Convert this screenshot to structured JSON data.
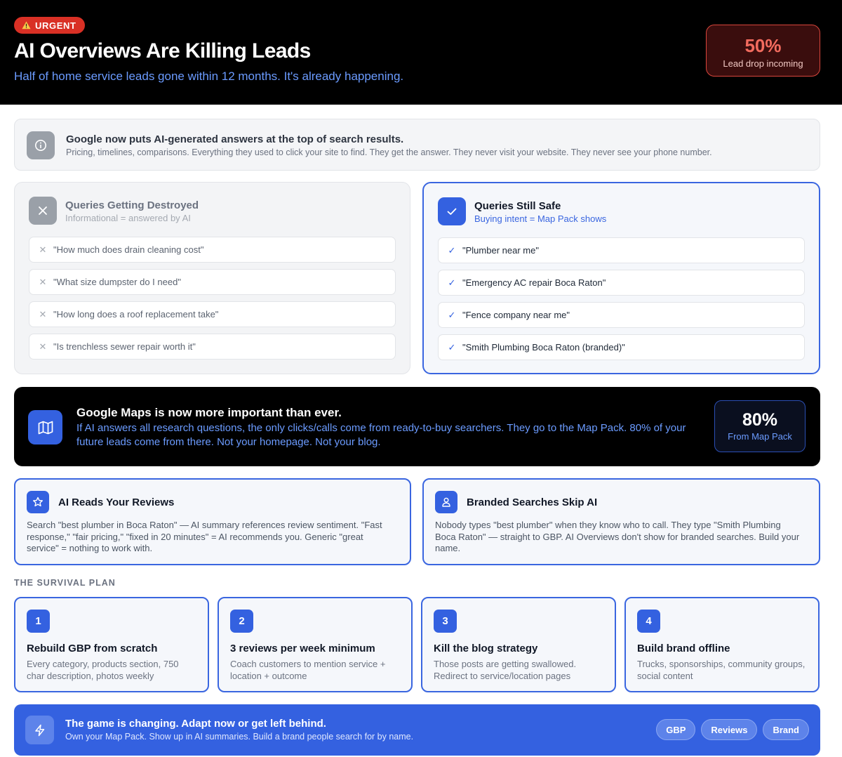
{
  "header": {
    "badge": "URGENT",
    "title": "AI Overviews Are Killing Leads",
    "subtitle": "Half of home service leads gone within 12 months. It's already happening.",
    "stat_value": "50%",
    "stat_label": "Lead drop incoming"
  },
  "info": {
    "icon": "info-icon",
    "title": "Google now puts AI-generated answers at the top of search results.",
    "description": "Pricing, timelines, comparisons. Everything they used to click your site to find. They get the answer. They never visit your website. They never see your phone number."
  },
  "destroyed": {
    "icon": "x-icon",
    "title": "Queries Getting Destroyed",
    "subtitle": "Informational = answered by AI",
    "items": [
      "\"How much does drain cleaning cost\"",
      "\"What size dumpster do I need\"",
      "\"How long does a roof replacement take\"",
      "\"Is trenchless sewer repair worth it\""
    ]
  },
  "safe": {
    "icon": "check-icon",
    "title": "Queries Still Safe",
    "subtitle": "Buying intent = Map Pack shows",
    "items": [
      "\"Plumber near me\"",
      "\"Emergency AC repair Boca Raton\"",
      "\"Fence company near me\"",
      "\"Smith Plumbing Boca Raton (branded)\""
    ]
  },
  "maps": {
    "icon": "map-icon",
    "title": "Google Maps is now more important than ever.",
    "description": "If AI answers all research questions, the only clicks/calls come from ready-to-buy searchers. They go to the Map Pack. 80% of your future leads come from there. Not your homepage. Not your blog.",
    "stat_value": "80%",
    "stat_label": "From Map Pack"
  },
  "features": [
    {
      "icon": "star-icon",
      "title": "AI Reads Your Reviews",
      "description": "Search \"best plumber in Boca Raton\" — AI summary references review sentiment. \"Fast response,\" \"fair pricing,\" \"fixed in 20 minutes\" = AI recommends you. Generic \"great service\" = nothing to work with."
    },
    {
      "icon": "user-icon",
      "title": "Branded Searches Skip AI",
      "description": "Nobody types \"best plumber\" when they know who to call. They type \"Smith Plumbing Boca Raton\" — straight to GBP. AI Overviews don't show for branded searches. Build your name."
    }
  ],
  "plan": {
    "label": "THE SURVIVAL PLAN",
    "steps": [
      {
        "num": "1",
        "title": "Rebuild GBP from scratch",
        "description": "Every category, products section, 750 char description, photos weekly"
      },
      {
        "num": "2",
        "title": "3 reviews per week minimum",
        "description": "Coach customers to mention service + location + outcome"
      },
      {
        "num": "3",
        "title": "Kill the blog strategy",
        "description": "Those posts are getting swallowed. Redirect to service/location pages"
      },
      {
        "num": "4",
        "title": "Build brand offline",
        "description": "Trucks, sponsorships, community groups, social content"
      }
    ]
  },
  "cta": {
    "icon": "lightning-icon",
    "title": "The game is changing. Adapt now or get left behind.",
    "description": "Own your Map Pack. Show up in AI summaries. Build a brand people search for by name.",
    "tags": [
      "GBP",
      "Reviews",
      "Brand"
    ]
  }
}
